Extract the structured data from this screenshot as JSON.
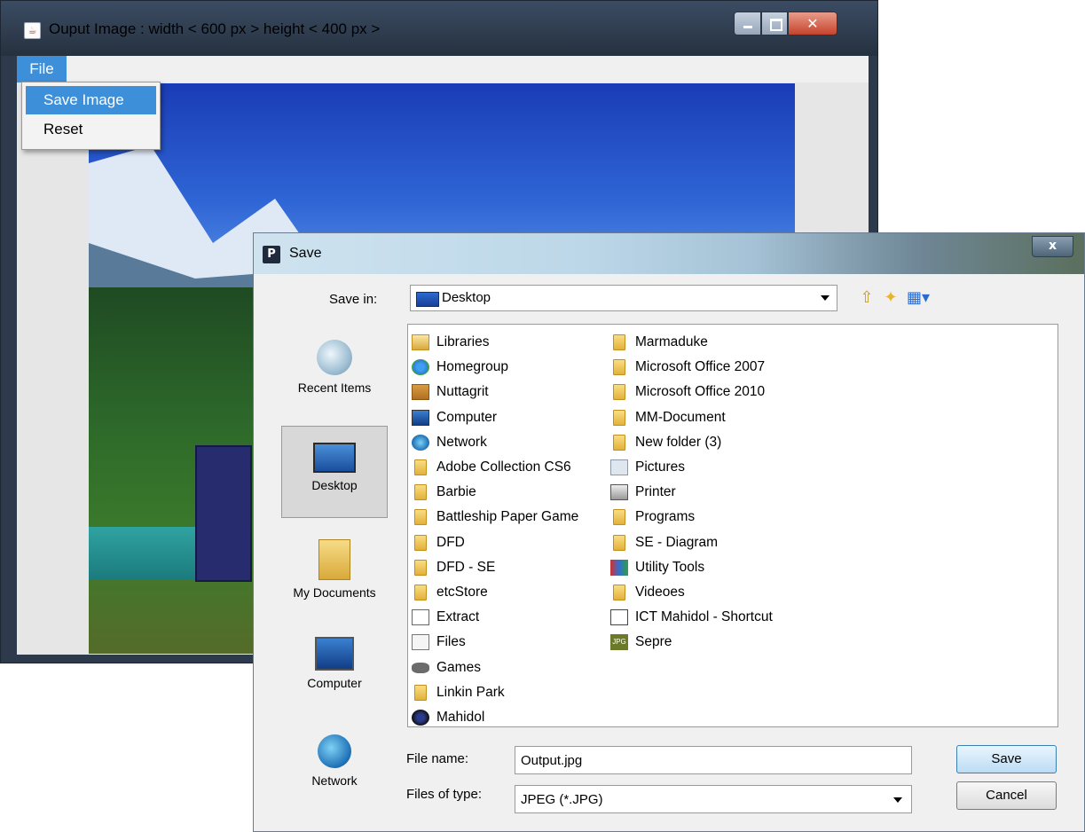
{
  "background_window": {
    "title": "Ouput Image :  width < 600 px > height < 400 px >",
    "app_icon": "java-icon",
    "menu": {
      "file_label": "File"
    },
    "file_menu_items": [
      "Save Image",
      "Reset"
    ]
  },
  "dialog": {
    "title": "Save",
    "app_icon_glyph": "P",
    "close_glyph": "x",
    "save_in_label": "Save in:",
    "save_in_value": "Desktop",
    "places": [
      "Recent Items",
      "Desktop",
      "My Documents",
      "Computer",
      "Network"
    ],
    "files_col1": [
      {
        "name": "Libraries",
        "icon": "libs"
      },
      {
        "name": "Homegroup",
        "icon": "home"
      },
      {
        "name": "Nuttagrit",
        "icon": "user"
      },
      {
        "name": "Computer",
        "icon": "computer"
      },
      {
        "name": "Network",
        "icon": "network"
      },
      {
        "name": "Adobe Collection CS6",
        "icon": "folder"
      },
      {
        "name": "Barbie",
        "icon": "folder"
      },
      {
        "name": "Battleship Paper Game",
        "icon": "folder"
      },
      {
        "name": "DFD",
        "icon": "folder"
      },
      {
        "name": "DFD - SE",
        "icon": "folder"
      },
      {
        "name": "etcStore",
        "icon": "folder"
      },
      {
        "name": "Extract",
        "icon": "extract"
      },
      {
        "name": "Files",
        "icon": "files"
      },
      {
        "name": "Games",
        "icon": "games"
      },
      {
        "name": "Linkin Park",
        "icon": "folder"
      },
      {
        "name": "Mahidol",
        "icon": "mahidol"
      }
    ],
    "files_col2": [
      {
        "name": "Marmaduke",
        "icon": "folder"
      },
      {
        "name": "Microsoft Office 2007",
        "icon": "folder"
      },
      {
        "name": "Microsoft Office 2010",
        "icon": "folder"
      },
      {
        "name": "MM-Document",
        "icon": "folder"
      },
      {
        "name": "New folder (3)",
        "icon": "folder"
      },
      {
        "name": "Pictures",
        "icon": "pictures"
      },
      {
        "name": "Printer",
        "icon": "printer"
      },
      {
        "name": "Programs",
        "icon": "folder"
      },
      {
        "name": "SE - Diagram",
        "icon": "folder"
      },
      {
        "name": "Utility Tools",
        "icon": "utility"
      },
      {
        "name": "Videoes",
        "icon": "folder"
      },
      {
        "name": "ICT Mahidol - Shortcut",
        "icon": "shortcut"
      },
      {
        "name": "Sepre",
        "icon": "jpg"
      }
    ],
    "file_name_label": "File name:",
    "file_name_value": "Output.jpg",
    "file_type_label": "Files of type:",
    "file_type_value": "JPEG (*.JPG)",
    "save_button": "Save",
    "cancel_button": "Cancel",
    "jpg_icon_text": "JPG"
  }
}
